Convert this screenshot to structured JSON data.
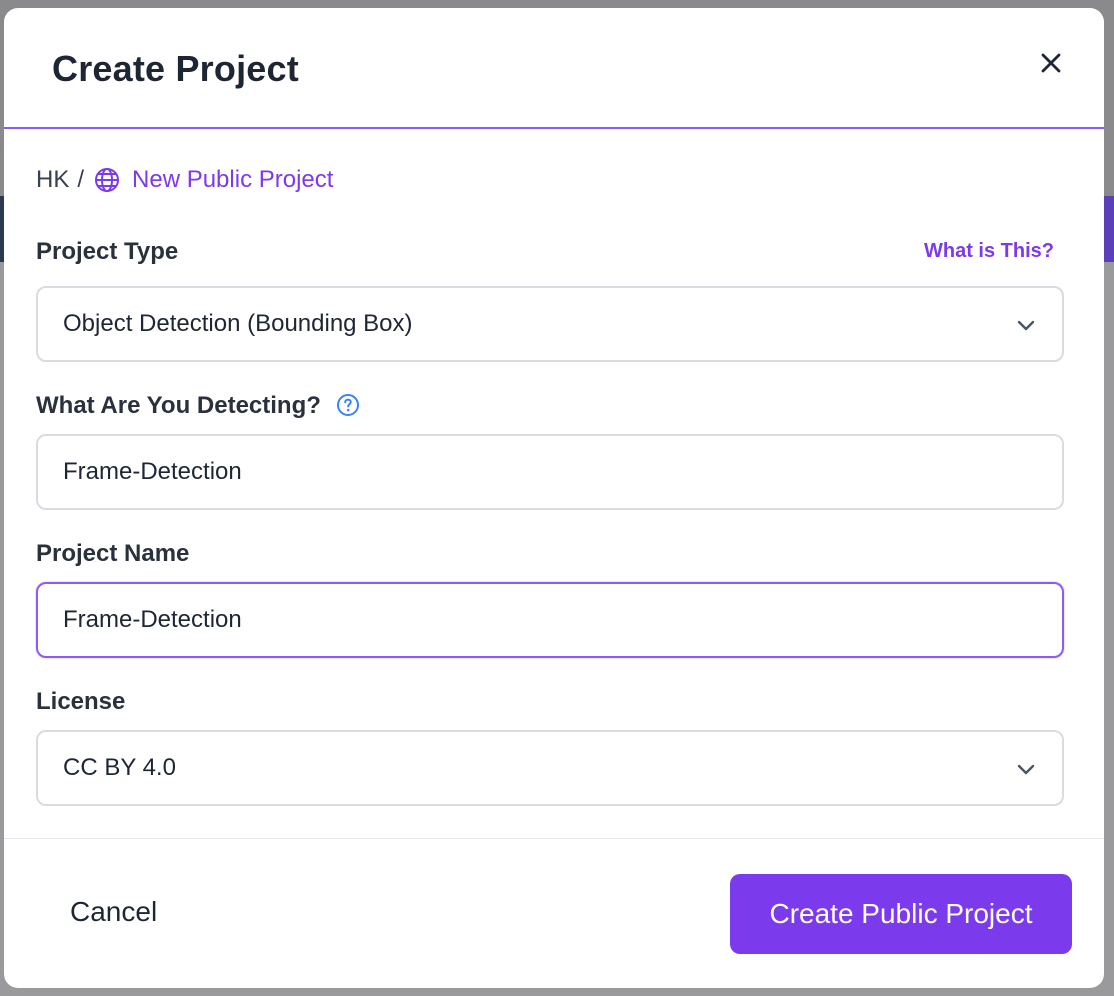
{
  "modal": {
    "title": "Create Project",
    "close_icon": "close-icon"
  },
  "breadcrumb": {
    "workspace": "HK",
    "separator": "/",
    "project_link": "New Public Project",
    "project_icon": "globe-icon"
  },
  "project_type": {
    "label": "Project Type",
    "help_link": "What is This?",
    "selected": "Object Detection (Bounding Box)"
  },
  "detecting": {
    "label": "What Are You Detecting?",
    "help_icon": "question-circle-icon",
    "value": "Frame-Detection"
  },
  "project_name": {
    "label": "Project Name",
    "value": "Frame-Detection"
  },
  "license": {
    "label": "License",
    "selected": "CC BY 4.0"
  },
  "footer": {
    "cancel_label": "Cancel",
    "create_label": "Create Public Project"
  },
  "colors": {
    "accent": "#7c3aed",
    "focus_border": "#8b5cf6",
    "help_blue": "#3b82f6",
    "text": "#1f2633"
  }
}
